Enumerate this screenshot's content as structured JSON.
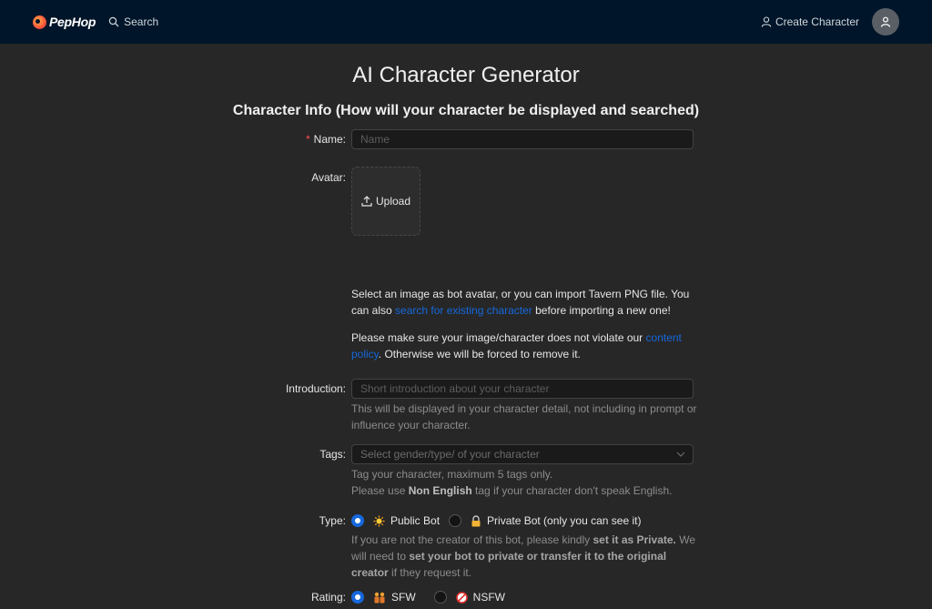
{
  "header": {
    "brand": "PepHop",
    "search_label": "Search",
    "create_label": "Create Character"
  },
  "page": {
    "title": "AI Character Generator",
    "section_title": "Character Info (How will your character be displayed and searched)"
  },
  "form": {
    "name": {
      "label": "Name:",
      "placeholder": "Name",
      "required_mark": "*"
    },
    "avatar": {
      "label": "Avatar:",
      "upload_label": "Upload",
      "help1_a": "Select an image as bot avatar, or you can import Tavern PNG file. You can also ",
      "help1_link": "search for existing character",
      "help1_b": " before importing a new one!",
      "help2_a": "Please make sure your image/character does not violate our ",
      "help2_link": "content policy",
      "help2_b": ". Otherwise we will be forced to remove it."
    },
    "introduction": {
      "label": "Introduction:",
      "placeholder": "Short introduction about your character",
      "help": "This will be displayed in your character detail, not including in prompt or influence your character."
    },
    "tags": {
      "label": "Tags:",
      "placeholder": "Select gender/type/ of your character",
      "help1": "Tag your character, maximum 5 tags only.",
      "help2_a": "Please use ",
      "help2_bold": "Non English",
      "help2_b": " tag if your character don't speak English."
    },
    "type": {
      "label": "Type:",
      "public_label": "Public Bot",
      "private_label": "Private Bot (only you can see it)",
      "selected": "Public Bot",
      "help_a": "If you are not the creator of this bot, please kindly ",
      "help_bold1": "set it as Private.",
      "help_b": " We will need to ",
      "help_bold2": "set your bot to private or transfer it to the original creator",
      "help_c": " if they request it."
    },
    "rating": {
      "label": "Rating:",
      "sfw_label": "SFW",
      "nsfw_label": "NSFW",
      "selected": "SFW"
    }
  },
  "colors": {
    "nav_bg": "#001529",
    "page_bg": "#272727",
    "accent": "#1668dc",
    "required": "#ff4d4f"
  },
  "icons": {
    "search": "search-icon",
    "user": "user-icon",
    "upload": "upload-icon",
    "chevron": "chevron-down-icon",
    "public": "sun-icon",
    "private": "lock-icon",
    "sfw": "dancers-icon",
    "nsfw": "no-entry-icon"
  }
}
